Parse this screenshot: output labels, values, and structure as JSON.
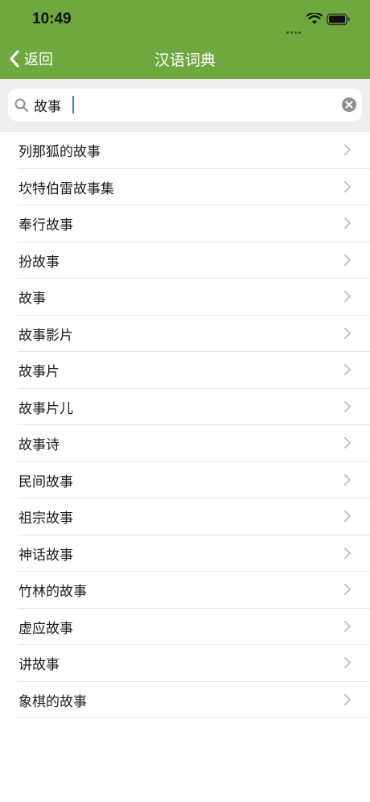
{
  "status": {
    "time": "10:49"
  },
  "nav": {
    "back_label": "返回",
    "title": "汉语词典"
  },
  "search": {
    "value": "故事"
  },
  "results": [
    {
      "label": "列那狐的故事"
    },
    {
      "label": "坎特伯雷故事集"
    },
    {
      "label": "奉行故事"
    },
    {
      "label": "扮故事"
    },
    {
      "label": "故事"
    },
    {
      "label": "故事影片"
    },
    {
      "label": "故事片"
    },
    {
      "label": "故事片儿"
    },
    {
      "label": "故事诗"
    },
    {
      "label": "民间故事"
    },
    {
      "label": "祖宗故事"
    },
    {
      "label": "神话故事"
    },
    {
      "label": "竹林的故事"
    },
    {
      "label": "虚应故事"
    },
    {
      "label": "讲故事"
    },
    {
      "label": "象棋的故事"
    }
  ],
  "colors": {
    "header": "#6fa83f",
    "search_bg": "#efefef",
    "separator": "#e5e5e5"
  },
  "icons": [
    "chevron-left-icon",
    "search-icon",
    "clear-icon",
    "chevron-right-icon",
    "wifi-icon",
    "battery-icon"
  ]
}
